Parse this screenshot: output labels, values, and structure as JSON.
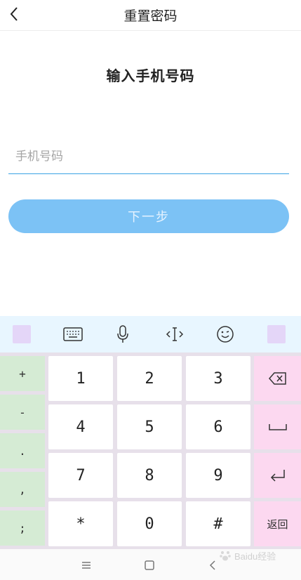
{
  "header": {
    "title": "重置密码"
  },
  "main": {
    "heading": "输入手机号码",
    "phone_placeholder": "手机号码",
    "next_label": "下一步"
  },
  "keyboard": {
    "side_keys": [
      "+",
      "-",
      ".",
      ",",
      ";"
    ],
    "num_keys": [
      "1",
      "2",
      "3",
      "4",
      "5",
      "6",
      "7",
      "8",
      "9",
      "*",
      "0",
      "#"
    ],
    "return_label": "返回"
  },
  "watermark": {
    "text": "Baidu经验"
  },
  "colors": {
    "accent": "#3aa3e3",
    "button": "#7cc2f5",
    "toolbar": "#e8f6ff",
    "side_key": "#d5ebd4",
    "fn_key": "#fcd8f0"
  }
}
